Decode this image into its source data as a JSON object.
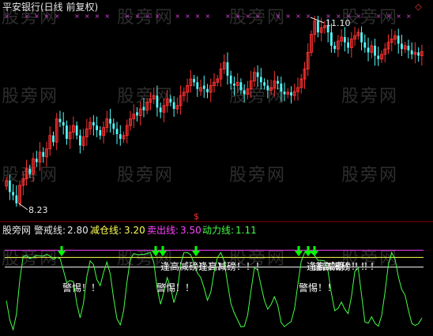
{
  "header": {
    "title": "平安银行(日线 前复权)",
    "settings_icon": "diamond-settings-icon"
  },
  "watermark": "股旁网",
  "indicator_bar": {
    "name": "股旁网",
    "items": [
      {
        "label": "警戒线:",
        "value": "2.80",
        "color": "#e8e8e8"
      },
      {
        "label": "减仓线:",
        "value": "3.20",
        "color": "#ffff55"
      },
      {
        "label": "卖出线:",
        "value": "3.50",
        "color": "#ff44ff"
      },
      {
        "label": "动力线:",
        "value": "1.11",
        "color": "#44ff44"
      }
    ]
  },
  "divider_marker": "$",
  "colors": {
    "up": "#ff3232",
    "down": "#54fcfc",
    "warn_line": "#ffffff",
    "reduce_line": "#ffff55",
    "sell_line": "#ff44ff",
    "power_line": "#44ff44",
    "signal": "#00ff00"
  },
  "chart_data": [
    {
      "type": "candlestick",
      "title": "平安银行(日线 前复权)",
      "annotations": {
        "high_label": "11.10",
        "low_label": "8.23"
      },
      "high": 11.1,
      "low": 8.23,
      "closes": [
        8.62,
        8.45,
        8.4,
        8.28,
        8.55,
        8.65,
        8.8,
        8.72,
        8.95,
        8.9,
        9.05,
        8.98,
        9.1,
        9.3,
        9.2,
        9.55,
        9.5,
        9.45,
        9.25,
        9.35,
        9.45,
        9.3,
        9.15,
        9.28,
        9.4,
        9.5,
        9.45,
        9.38,
        9.3,
        9.42,
        9.55,
        9.48,
        9.4,
        9.32,
        9.25,
        9.3,
        9.45,
        9.55,
        9.62,
        9.6,
        9.7,
        9.68,
        9.8,
        9.85,
        9.9,
        9.72,
        9.65,
        9.75,
        9.85,
        9.8,
        9.7,
        9.75,
        9.9,
        9.95,
        10.05,
        10.15,
        10.1,
        10.0,
        10.02,
        10.0,
        9.95,
        10.05,
        10.1,
        10.15,
        10.3,
        10.4,
        10.2,
        10.08,
        10.05,
        10.1,
        9.98,
        9.92,
        10.0,
        10.12,
        10.25,
        10.18,
        10.1,
        10.05,
        9.98,
        10.02,
        10.12,
        10.08,
        9.96,
        9.92,
        9.95,
        9.9,
        9.96,
        10.02,
        10.15,
        10.3,
        10.55,
        10.82,
        11.02,
        10.85,
        10.92,
        10.95,
        10.85,
        10.65,
        10.6,
        10.72,
        10.78,
        10.7,
        10.62,
        10.75,
        10.8,
        10.85,
        10.7,
        10.62,
        10.55,
        10.65,
        10.5,
        10.45,
        10.52,
        10.6,
        10.7,
        10.75,
        10.8,
        10.68,
        10.6,
        10.65,
        10.58,
        10.52,
        10.55,
        10.5,
        10.56
      ]
    },
    {
      "type": "line",
      "series": [
        {
          "name": "动力线",
          "last_value": 1.11
        }
      ],
      "levels": [
        {
          "name": "警戒线",
          "value": 2.8
        },
        {
          "name": "减仓线",
          "value": 3.2
        },
        {
          "name": "卖出线",
          "value": 3.5
        }
      ],
      "labels": [
        {
          "text": "警惕！！"
        },
        {
          "text": "逢高减磅！！！"
        },
        {
          "text": "警惕！！"
        },
        {
          "text": "逢高减磅！！！"
        },
        {
          "text": "警惕！！"
        },
        {
          "text": "逢高减磅！！！"
        },
        {
          "text": "逢高减磅！！！"
        }
      ]
    }
  ]
}
